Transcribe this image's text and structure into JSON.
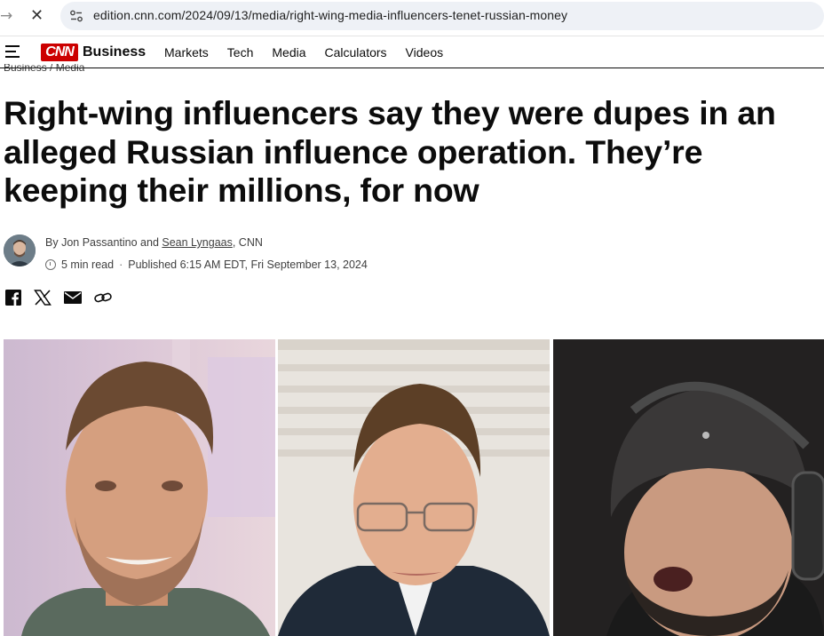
{
  "browser": {
    "url": "edition.cnn.com/2024/09/13/media/right-wing-media-influencers-tenet-russian-money",
    "back_icon": "arrow-left-icon",
    "stop_icon": "close-icon"
  },
  "nav": {
    "logo_text": "CNN",
    "brand": "Business",
    "links": [
      "Markets",
      "Tech",
      "Media",
      "Calculators",
      "Videos"
    ]
  },
  "breadcrumb": {
    "section": "Business",
    "separator": "/",
    "subsection": "Media"
  },
  "article": {
    "headline": "Right-wing influencers say they were dupes in an alleged Russian influence operation. They’re keeping their millions, for now",
    "byline_prefix": "By",
    "author1": "Jon Passantino",
    "and": "and",
    "author2": "Sean Lyngaas",
    "outlet": ", CNN",
    "read_time": "5 min read",
    "separator": "·",
    "published": "Published 6:15 AM EDT, Fri September 13, 2024"
  },
  "share": {
    "icons": [
      "facebook-icon",
      "x-icon",
      "email-icon",
      "link-icon"
    ]
  },
  "colors": {
    "brand_red": "#cc0000",
    "text": "#0c0c0c",
    "meta": "#404040"
  }
}
